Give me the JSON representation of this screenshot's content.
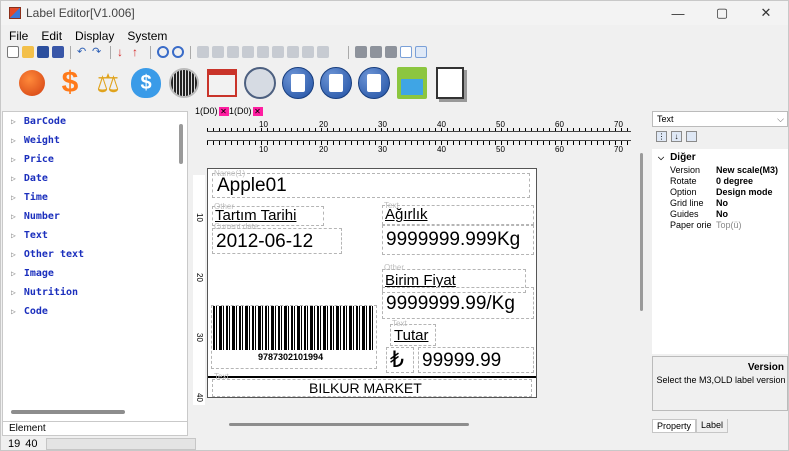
{
  "window": {
    "title": "Label Editor[V1.006]"
  },
  "menu": [
    "File",
    "Edit",
    "Display",
    "System"
  ],
  "sidebar": {
    "items": [
      {
        "label": "BarCode"
      },
      {
        "label": "Weight"
      },
      {
        "label": "Price"
      },
      {
        "label": "Date"
      },
      {
        "label": "Time"
      },
      {
        "label": "Number"
      },
      {
        "label": "Text"
      },
      {
        "label": "Other text"
      },
      {
        "label": "Image"
      },
      {
        "label": "Nutrition"
      },
      {
        "label": "Code"
      }
    ],
    "bottom_tab": "Element"
  },
  "status": {
    "left": "19",
    "right": "40"
  },
  "tabs": [
    {
      "label": "1(D0"
    },
    {
      "label": "1(D0"
    }
  ],
  "ruler": {
    "marks": [
      "10",
      "20",
      "30",
      "40",
      "50",
      "60",
      "70"
    ],
    "vmarks": [
      "10",
      "20",
      "30",
      "40"
    ]
  },
  "label": {
    "name_tag": "Name(1)",
    "name_value": "Apple01",
    "other_tag": "Other",
    "other_value": "Tartım Tarihi",
    "date_tag": "Current date",
    "date_value": "2012-06-12",
    "text_tag": "Text",
    "weight_title": "Ağırlık",
    "weight_value": "9999999.999Kg",
    "other2_tag": "Other",
    "unitprice_title": "Birim Fiyat",
    "unitprice_value": "9999999.99/Kg",
    "text2_tag": "Text",
    "total_title": "Tutar",
    "currency": "₺",
    "total_value": "99999.99",
    "barcode_number": "9787302101994",
    "text3_tag": "Text",
    "footer": "BILKUR MARKET"
  },
  "properties": {
    "selected": "Text",
    "category": "Diğer",
    "rows": [
      {
        "key": "Version",
        "value": "New scale(M3)"
      },
      {
        "key": "Rotate",
        "value": "0 degree"
      },
      {
        "key": "Option",
        "value": "Design mode"
      },
      {
        "key": "Grid line",
        "value": "No"
      },
      {
        "key": "Guides",
        "value": "No"
      },
      {
        "key": "Paper orie",
        "value": "Top(ü)"
      }
    ],
    "desc_title": "Version",
    "desc_text": "Select the M3,OLD label version",
    "tabs": [
      "Property",
      "Label"
    ]
  }
}
